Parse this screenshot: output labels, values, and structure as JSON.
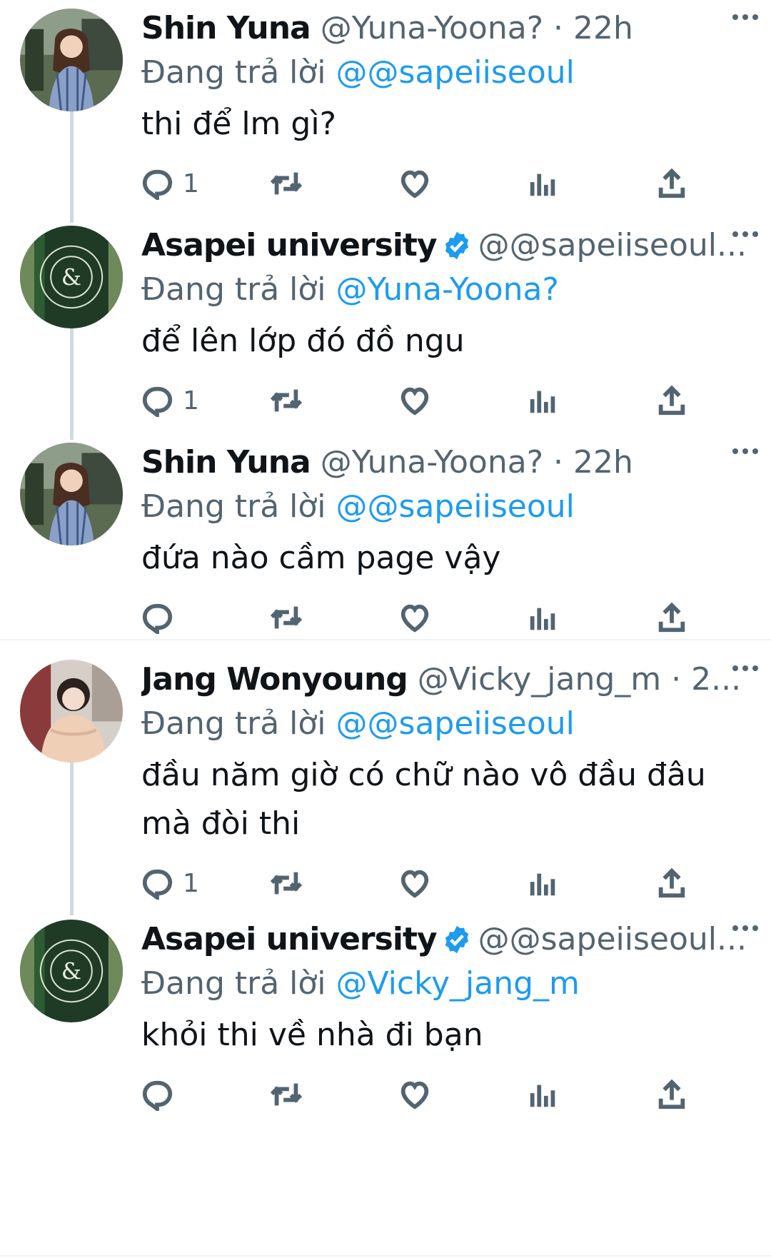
{
  "reply_prefix": "Đang trả lời",
  "tweets": [
    {
      "name": "Shin Yuna",
      "handle": "@Yuna-Yoona? · 22h",
      "reply_to": "@@sapeiiseoul",
      "text": "thi để lm gì?",
      "reply_count": "1",
      "verified": false
    },
    {
      "name": "Asapei university",
      "handle": "@@sapeiiseoul...",
      "reply_to": "@Yuna-Yoona?",
      "text": "để lên lớp đó đồ ngu",
      "reply_count": "1",
      "verified": true
    },
    {
      "name": "Shin Yuna",
      "handle": "@Yuna-Yoona? · 22h",
      "reply_to": "@@sapeiiseoul",
      "text": "đứa nào cầm page vậy",
      "reply_count": "",
      "verified": false
    },
    {
      "name": "Jang Wonyoung",
      "handle": "@Vicky_jang_m · 2...",
      "reply_to": "@@sapeiiseoul",
      "text": "đầu năm giờ có chữ nào vô đầu đâu mà đòi thi",
      "reply_count": "1",
      "verified": false
    },
    {
      "name": "Asapei university",
      "handle": "@@sapeiiseoul...",
      "reply_to": "@Vicky_jang_m",
      "text": "khỏi thi về nhà đi bạn",
      "reply_count": "",
      "verified": true
    }
  ],
  "avatars": {
    "yuna": "user-photo",
    "asapei": "school-logo",
    "wonyoung": "user-photo"
  },
  "colors": {
    "accent": "#1d9bf0",
    "muted": "#536471",
    "thread_line": "#cfd9de",
    "logo_dark": "#1f3b26",
    "logo_light": "#6e8a5a"
  }
}
